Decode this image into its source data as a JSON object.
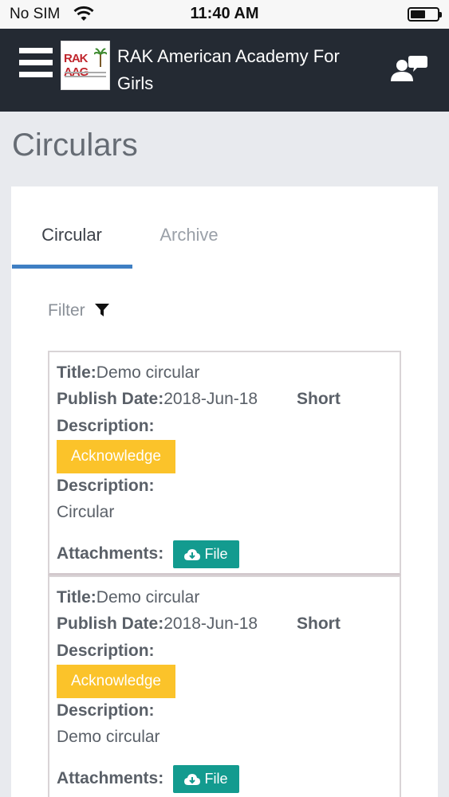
{
  "status_bar": {
    "carrier": "No SIM",
    "time": "11:40 AM",
    "battery_level": 0.55
  },
  "header": {
    "logo_text": "RAK AAG",
    "school_name": "RAK American Academy For Girls",
    "icons": [
      "menu-icon",
      "contact-chat-icon"
    ]
  },
  "page": {
    "title": "Circulars"
  },
  "tabs": [
    {
      "label": "Circular",
      "active": true
    },
    {
      "label": "Archive",
      "active": false
    }
  ],
  "filter": {
    "label": "Filter",
    "icon": "filter-icon"
  },
  "labels": {
    "title": "Title:",
    "publish_date": "Publish Date:",
    "short": "Short",
    "description": "Description:",
    "attachments": "Attachments:"
  },
  "circulars": [
    {
      "title": "Demo circular",
      "publish_date": "2018-Jun-18",
      "acknowledge_label": "Acknowledge",
      "description": "Circular",
      "file_label": "File"
    },
    {
      "title": "Demo circular",
      "publish_date": "2018-Jun-18",
      "acknowledge_label": "Acknowledge",
      "description": "Demo circular",
      "file_label": "File"
    }
  ],
  "colors": {
    "navbar": "#242a33",
    "tab_underline": "#3f7fc3",
    "acknowledge": "#fbc32a",
    "file_button": "#139b8f"
  }
}
